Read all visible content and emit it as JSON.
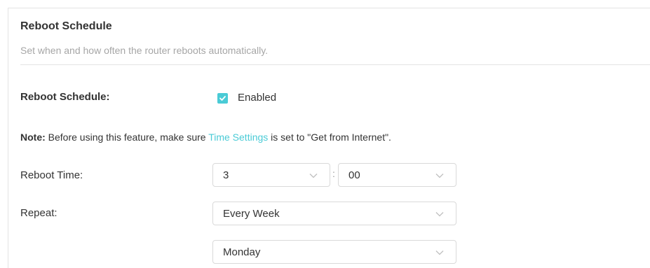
{
  "section": {
    "title": "Reboot Schedule",
    "subtitle": "Set when and how often the router reboots automatically."
  },
  "schedule": {
    "label": "Reboot Schedule:",
    "checkbox_checked": true,
    "checkbox_label": "Enabled"
  },
  "note": {
    "prefix": "Note:",
    "text_before": " Before using this feature, make sure ",
    "link": "Time Settings",
    "text_after": " is set to \"Get from Internet\"."
  },
  "reboot_time": {
    "label": "Reboot Time:",
    "hour": "3",
    "separator": ":",
    "minute": "00"
  },
  "repeat": {
    "label": "Repeat:",
    "frequency": "Every Week",
    "day": "Monday"
  },
  "colors": {
    "accent": "#4acbd6",
    "subtitle": "#a6a6a6",
    "border": "#d9d9d9"
  },
  "icons": {
    "checkbox": "checkmark-icon",
    "dropdown": "chevron-down-icon"
  }
}
